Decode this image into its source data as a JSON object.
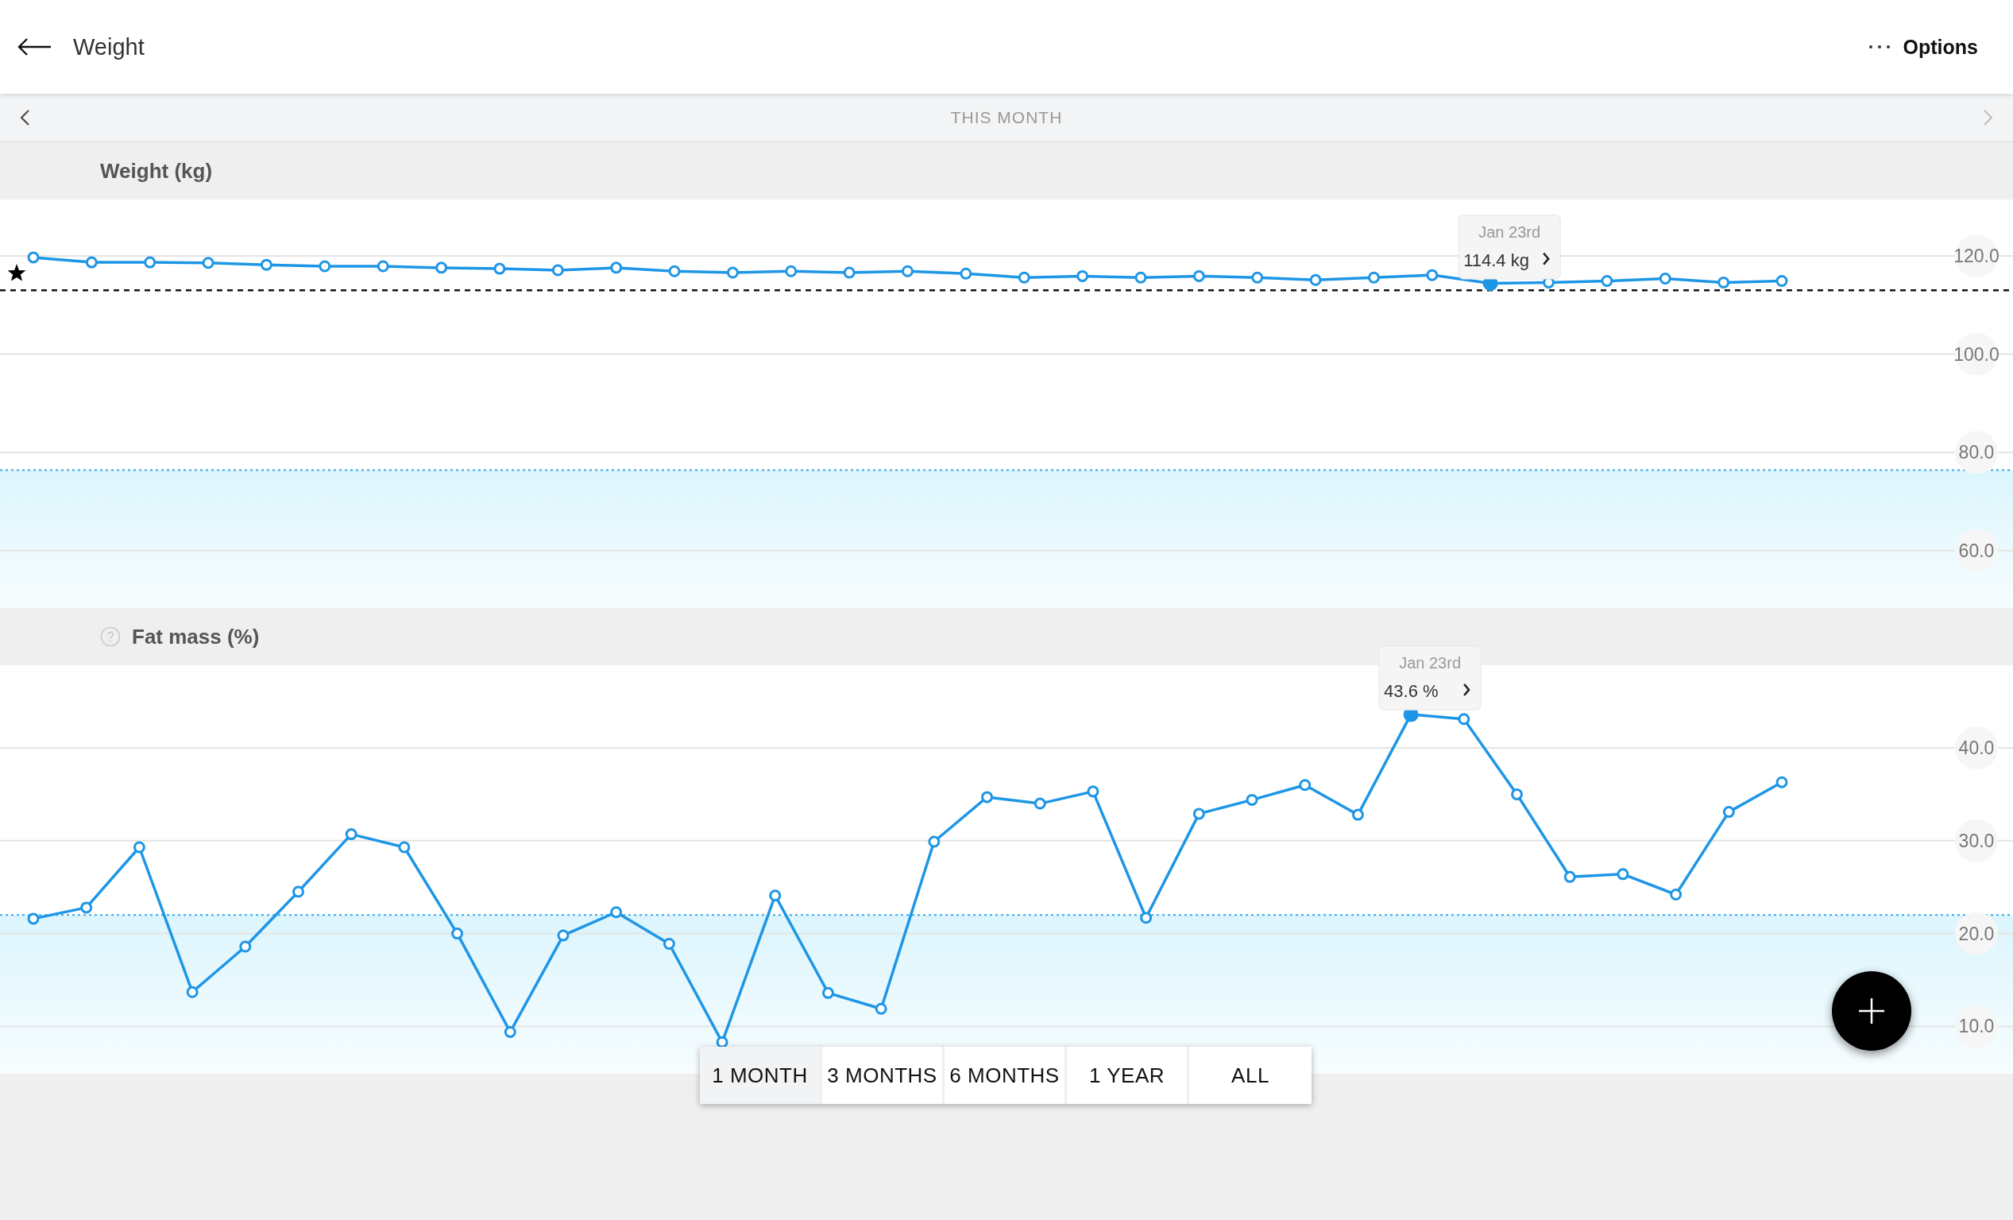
{
  "header": {
    "title": "Weight",
    "options_label": "Options"
  },
  "period_nav": {
    "label": "THIS MONTH",
    "prev": {
      "disabled": false
    },
    "next": {
      "disabled": true
    }
  },
  "sections": [
    {
      "help_icon": false,
      "star_icon": true,
      "tooltip_date": "Jan 23rd",
      "chart_data": {
        "type": "line",
        "title": "Weight (kg)",
        "ylim": [
          48.3,
          131.5
        ],
        "yticks": [
          {
            "value": 120,
            "label": "120.0"
          },
          {
            "value": 100,
            "label": "100.0"
          },
          {
            "value": 80,
            "label": "80.0"
          },
          {
            "value": 60,
            "label": "60.0"
          }
        ],
        "categories": [
          null,
          null,
          null,
          null,
          null,
          null,
          null,
          null,
          null,
          null,
          null,
          null,
          null,
          null,
          null,
          null,
          null,
          null,
          null,
          null,
          null,
          null,
          null,
          null,
          null,
          null,
          null,
          null,
          null,
          null,
          null
        ],
        "series": [
          {
            "color": "#1e96e6",
            "marker": "circle",
            "values": [
              119.7,
              118.7,
              118.7,
              118.6,
              118.2,
              117.9,
              117.9,
              117.6,
              117.4,
              117.1,
              117.6,
              116.9,
              116.6,
              116.9,
              116.6,
              116.9,
              116.4,
              115.6,
              115.9,
              115.6,
              115.9,
              115.6,
              115.1,
              115.6,
              116.1,
              114.4,
              114.6,
              114.9,
              115.4,
              114.6,
              114.9
            ]
          }
        ],
        "grid": true,
        "ref_lines": [
          {
            "axis": "y",
            "value": 113.0,
            "color": "#111111"
          },
          {
            "axis": "y",
            "value": 76.4,
            "color": "#3aa7e8"
          }
        ],
        "bands": [
          {
            "axis": "y",
            "from": 48.3,
            "to": 76.4
          }
        ],
        "annotations": [
          {
            "y": 114.4,
            "text": "114.4 kg"
          }
        ]
      }
    },
    {
      "help_icon": true,
      "star_icon": false,
      "tooltip_date": "Jan 23rd",
      "chart_data": {
        "type": "line",
        "title": "Fat mass (%)",
        "ylim": [
          4.9,
          48.9
        ],
        "yticks": [
          {
            "value": 40,
            "label": "40.0"
          },
          {
            "value": 30,
            "label": "30.0"
          },
          {
            "value": 20,
            "label": "20.0"
          },
          {
            "value": 10,
            "label": "10.0"
          }
        ],
        "categories": [
          null,
          null,
          null,
          null,
          null,
          null,
          null,
          null,
          null,
          null,
          null,
          null,
          null,
          null,
          null,
          null,
          null,
          null,
          null,
          null,
          null,
          null,
          null,
          null,
          null,
          null,
          null,
          null,
          null,
          null,
          null,
          null,
          null,
          null
        ],
        "series": [
          {
            "color": "#1e96e6",
            "marker": "circle",
            "values": [
              21.6,
              22.8,
              29.3,
              13.7,
              18.6,
              24.5,
              30.7,
              29.3,
              20.0,
              9.4,
              19.8,
              22.3,
              18.9,
              8.3,
              24.1,
              13.6,
              11.9,
              29.9,
              34.7,
              34.0,
              35.3,
              21.7,
              32.9,
              34.4,
              36.0,
              32.8,
              43.6,
              43.1,
              35.0,
              26.1,
              26.4,
              24.2,
              33.1,
              36.3
            ]
          }
        ],
        "grid": true,
        "ref_lines": [
          {
            "axis": "y",
            "value": 22.0,
            "color": "#3aa7e8"
          }
        ],
        "bands": [
          {
            "axis": "y",
            "from": 4.9,
            "to": 22.0
          }
        ],
        "annotations": [
          {
            "y": 43.6,
            "text": "43.6 %"
          }
        ]
      }
    }
  ],
  "ranges": [
    {
      "label": "1 MONTH",
      "selected": true
    },
    {
      "label": "3 MONTHS",
      "selected": false
    },
    {
      "label": "6 MONTHS",
      "selected": false
    },
    {
      "label": "1 YEAR",
      "selected": false
    },
    {
      "label": "ALL",
      "selected": false
    }
  ]
}
